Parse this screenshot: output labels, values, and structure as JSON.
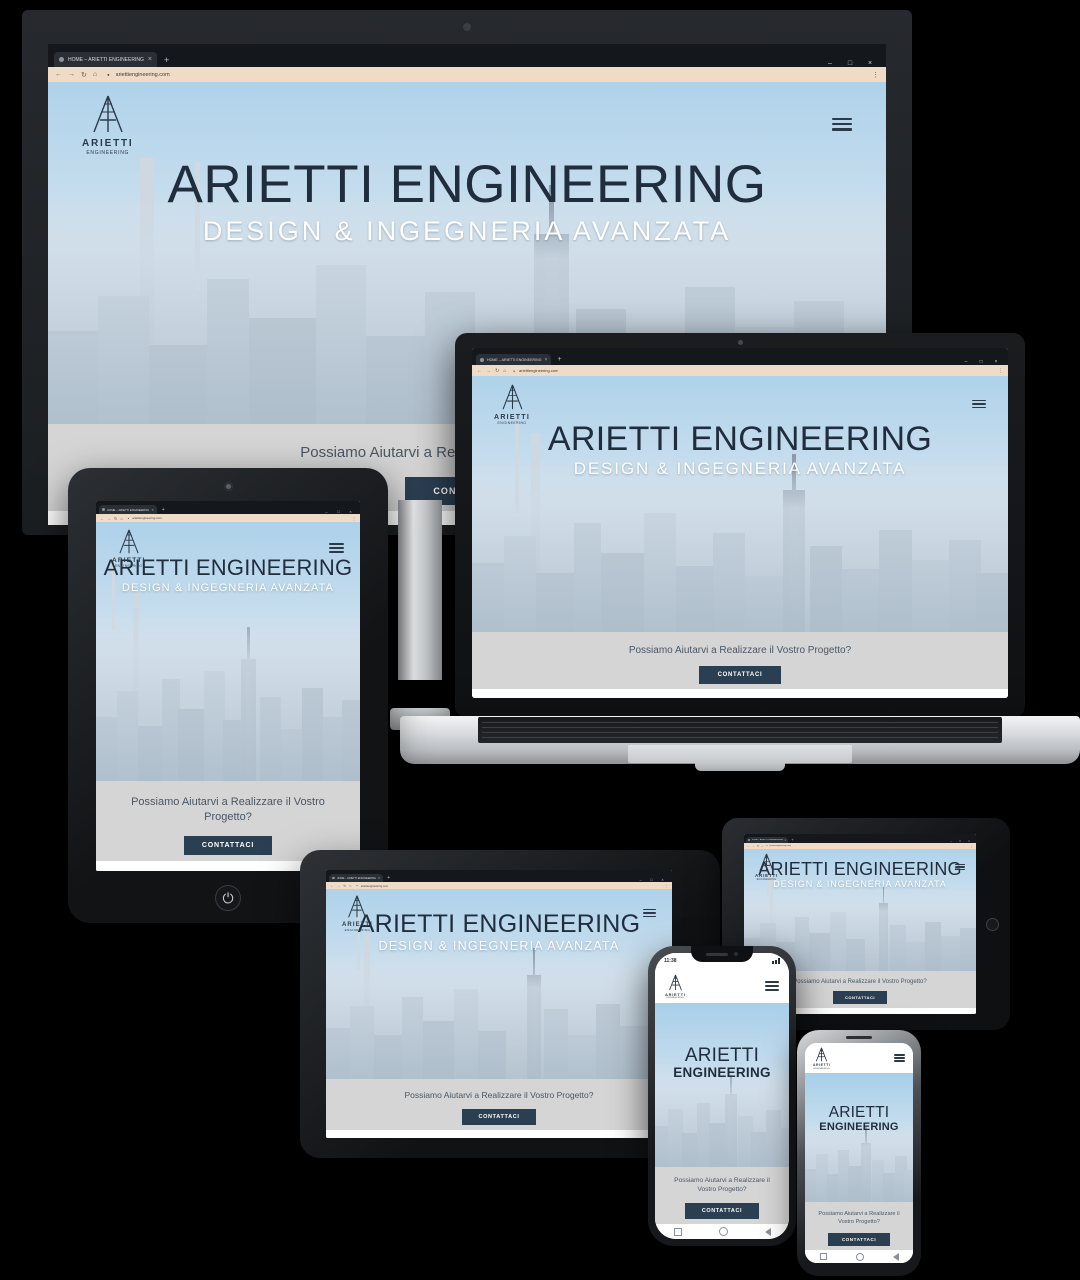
{
  "meta": {
    "background_color": "#000000",
    "scene": "responsive-device-mockup"
  },
  "browser": {
    "tab_title": "HOME – ARIETTI ENGINEERING",
    "tab_close_label": "×",
    "new_tab_label": "+",
    "back_icon": "←",
    "forward_icon": "→",
    "reload_icon": "↻",
    "home_icon": "⌂",
    "lock_icon": "●",
    "url": "ariettiengineering.com",
    "menu_icon": "⋮",
    "window_minimize": "–",
    "window_maximize": "□",
    "window_close": "×"
  },
  "site": {
    "logo": {
      "monogram": "A",
      "name": "ARIETTI",
      "tagline": "ENGINEERING"
    },
    "menu_button_label": "menu",
    "hero": {
      "title": "ARIETTI ENGINEERING",
      "subtitle": "DESIGN & INGEGNERIA AVANZATA"
    },
    "cta": {
      "text": "Possiamo Aiutarvi a Realizzare il Vostro Progetto?",
      "button_label": "CONTATTACI"
    },
    "colors": {
      "headline": "#1f2d3d",
      "subtitle": "#ffffff",
      "cta_band": "#d5d5d5",
      "cta_button": "#2b3f52",
      "logo": "#2b3a4a"
    }
  },
  "phone": {
    "status_time": "11:38",
    "nav_back_icon": "◁",
    "nav_home_icon": "○",
    "nav_recents_icon": "□"
  },
  "devices": [
    {
      "id": "desktop",
      "label": "Desktop Monitor"
    },
    {
      "id": "laptop",
      "label": "Laptop"
    },
    {
      "id": "tablet-p",
      "label": "Tablet Portrait"
    },
    {
      "id": "tablet-l",
      "label": "Tablet Landscape"
    },
    {
      "id": "tablet-s",
      "label": "Small Tablet Landscape"
    },
    {
      "id": "phone-n",
      "label": "Phone With Notch"
    },
    {
      "id": "phone-s",
      "label": "Phone"
    }
  ]
}
